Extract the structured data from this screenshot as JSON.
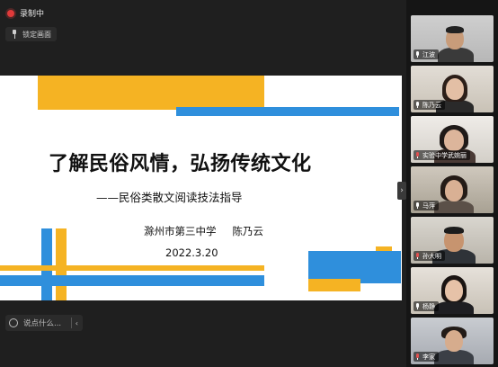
{
  "recording": {
    "status_label": "录制中",
    "indicator_color": "#e03a3a"
  },
  "lock_button": {
    "label": "锁定画面"
  },
  "slide": {
    "title": "了解民俗风情，弘扬传统文化",
    "subtitle": "——民俗类散文阅读技法指导",
    "school": "滁州市第三中学",
    "author": "陈乃云",
    "date": "2022.3.20",
    "accent_colors": {
      "orange": "#f5b323",
      "blue": "#2f8fdc"
    }
  },
  "chat": {
    "placeholder": "说点什么...",
    "collapse_arrow": "chevron-left-icon"
  },
  "expand_panel": {
    "icon": "chevron-right-icon"
  },
  "participants": [
    {
      "name": "江波",
      "mic_icon": "microphone-icon"
    },
    {
      "name": "陈乃云",
      "mic_icon": "microphone-icon"
    },
    {
      "name": "实验中学武婉丽",
      "mic_icon": "microphone-muted-icon"
    },
    {
      "name": "马萍",
      "mic_icon": "microphone-icon",
      "active": true
    },
    {
      "name": "孙大明",
      "mic_icon": "microphone-muted-icon"
    },
    {
      "name": "杨静",
      "mic_icon": "microphone-icon"
    },
    {
      "name": "李家",
      "mic_icon": "microphone-muted-icon"
    }
  ],
  "active_speaker_color": "#3fb56b"
}
